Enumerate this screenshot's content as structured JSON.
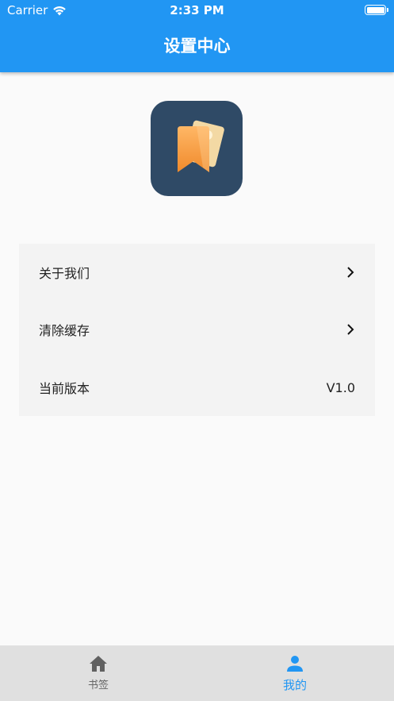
{
  "status_bar": {
    "carrier": "Carrier",
    "time": "2:33 PM"
  },
  "header": {
    "title": "设置中心"
  },
  "menu": {
    "items": [
      {
        "label": "关于我们",
        "icon": "chevron-right-icon"
      },
      {
        "label": "清除缓存",
        "icon": "chevron-right-icon"
      },
      {
        "label": "当前版本",
        "value": "V1.0"
      }
    ]
  },
  "tabbar": {
    "tabs": [
      {
        "label": "书签",
        "icon": "home-icon",
        "active": false
      },
      {
        "label": "我的",
        "icon": "person-icon",
        "active": true
      }
    ]
  },
  "colors": {
    "primary": "#2196f3",
    "icon_bg": "#2f4a66",
    "icon_accent": "#f5a04a"
  }
}
